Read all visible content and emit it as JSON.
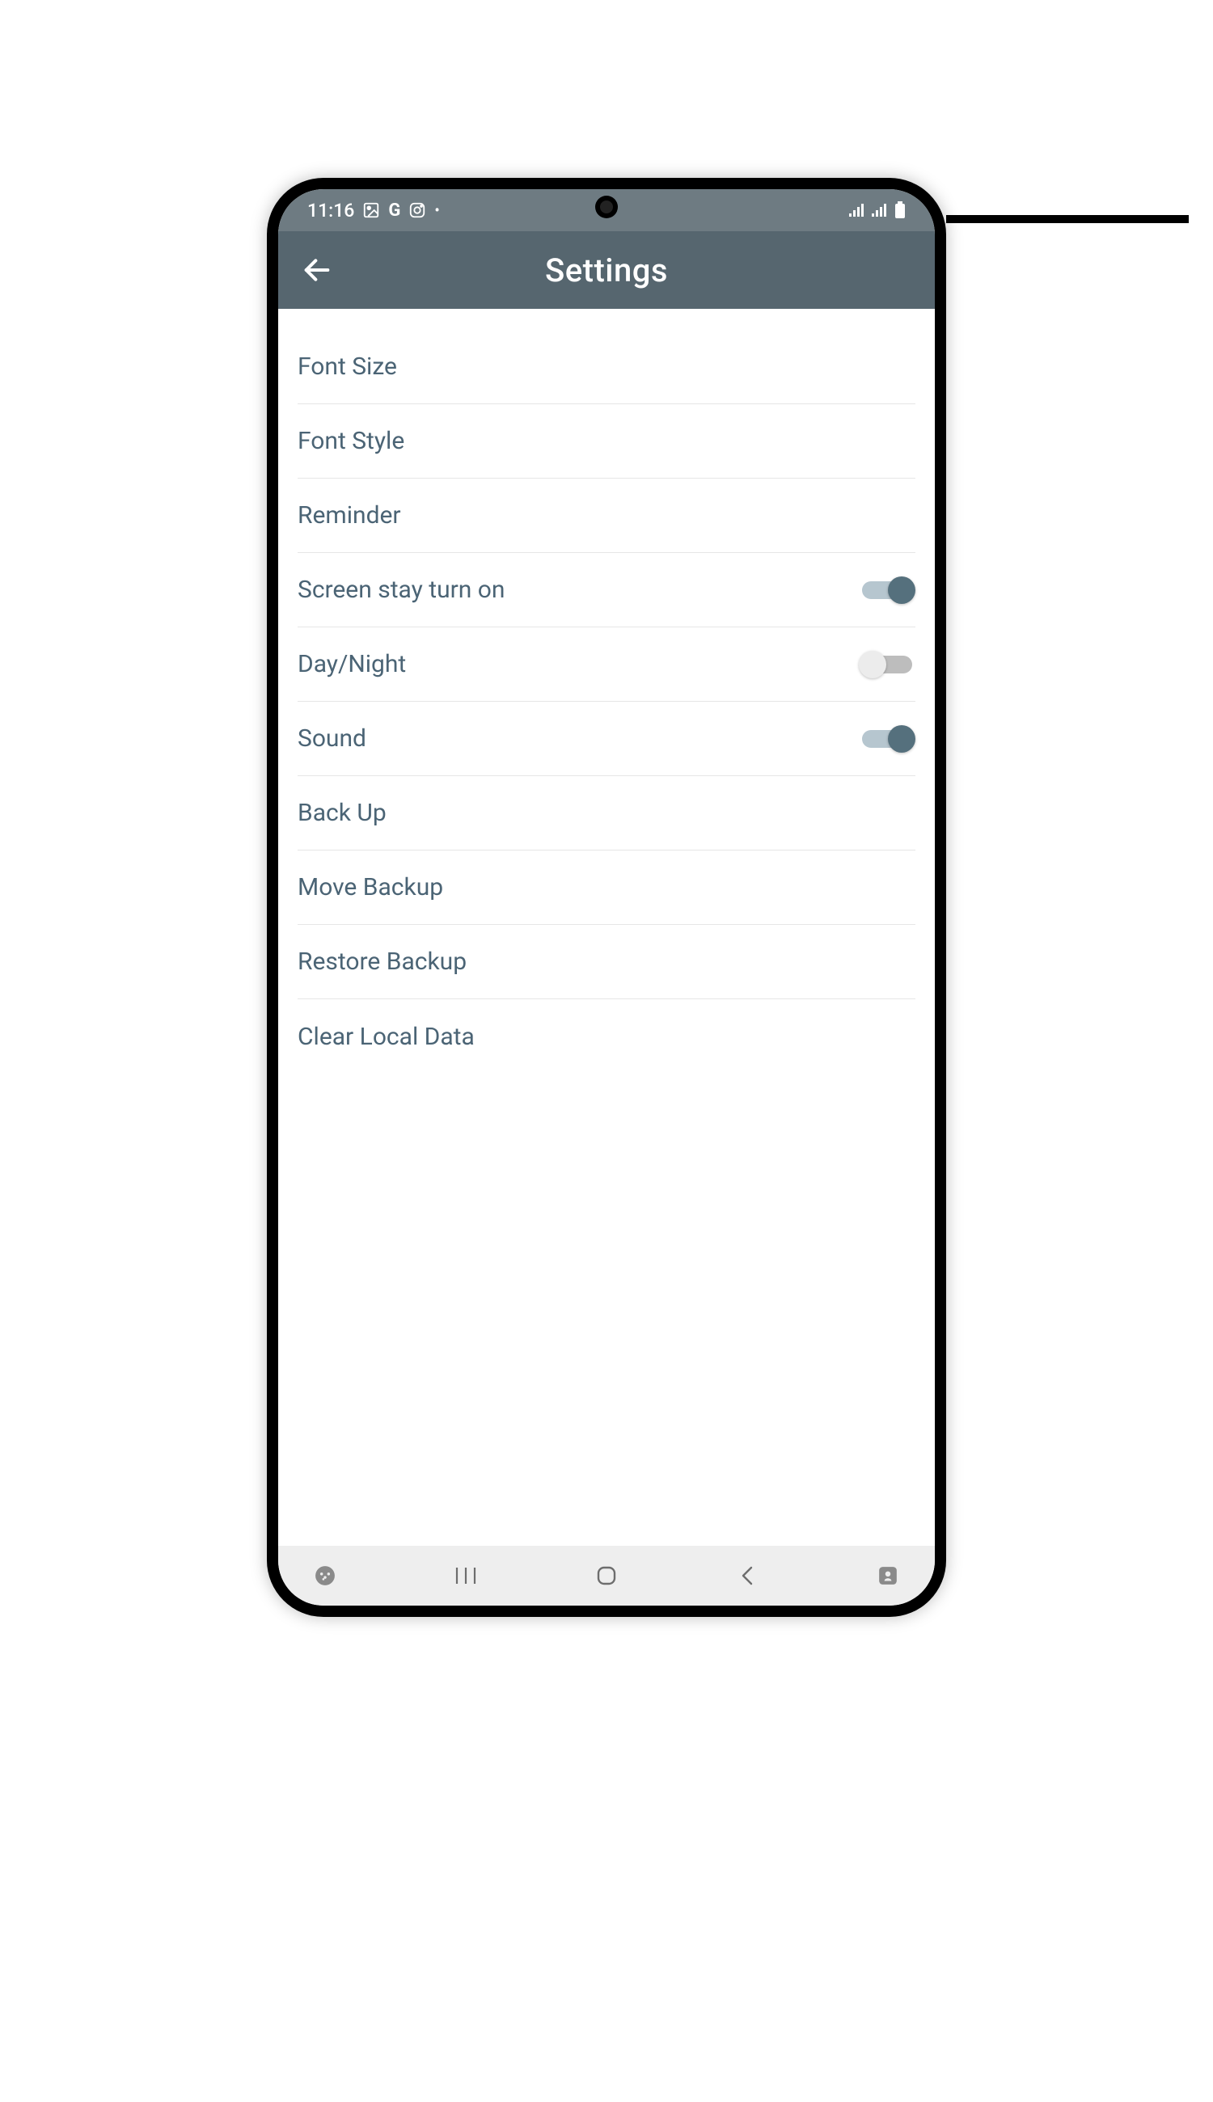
{
  "status_bar": {
    "time": "11:16"
  },
  "app_bar": {
    "title": "Settings"
  },
  "settings": {
    "items": [
      {
        "label": "Font Size",
        "type": "link"
      },
      {
        "label": "Font Style",
        "type": "link"
      },
      {
        "label": "Reminder",
        "type": "link"
      },
      {
        "label": "Screen stay turn on",
        "type": "toggle",
        "on": true
      },
      {
        "label": "Day/Night",
        "type": "toggle",
        "on": false
      },
      {
        "label": "Sound",
        "type": "toggle",
        "on": true
      },
      {
        "label": "Back Up",
        "type": "link"
      },
      {
        "label": "Move Backup",
        "type": "link"
      },
      {
        "label": "Restore Backup",
        "type": "link"
      },
      {
        "label": "Clear Local Data",
        "type": "link"
      }
    ]
  }
}
